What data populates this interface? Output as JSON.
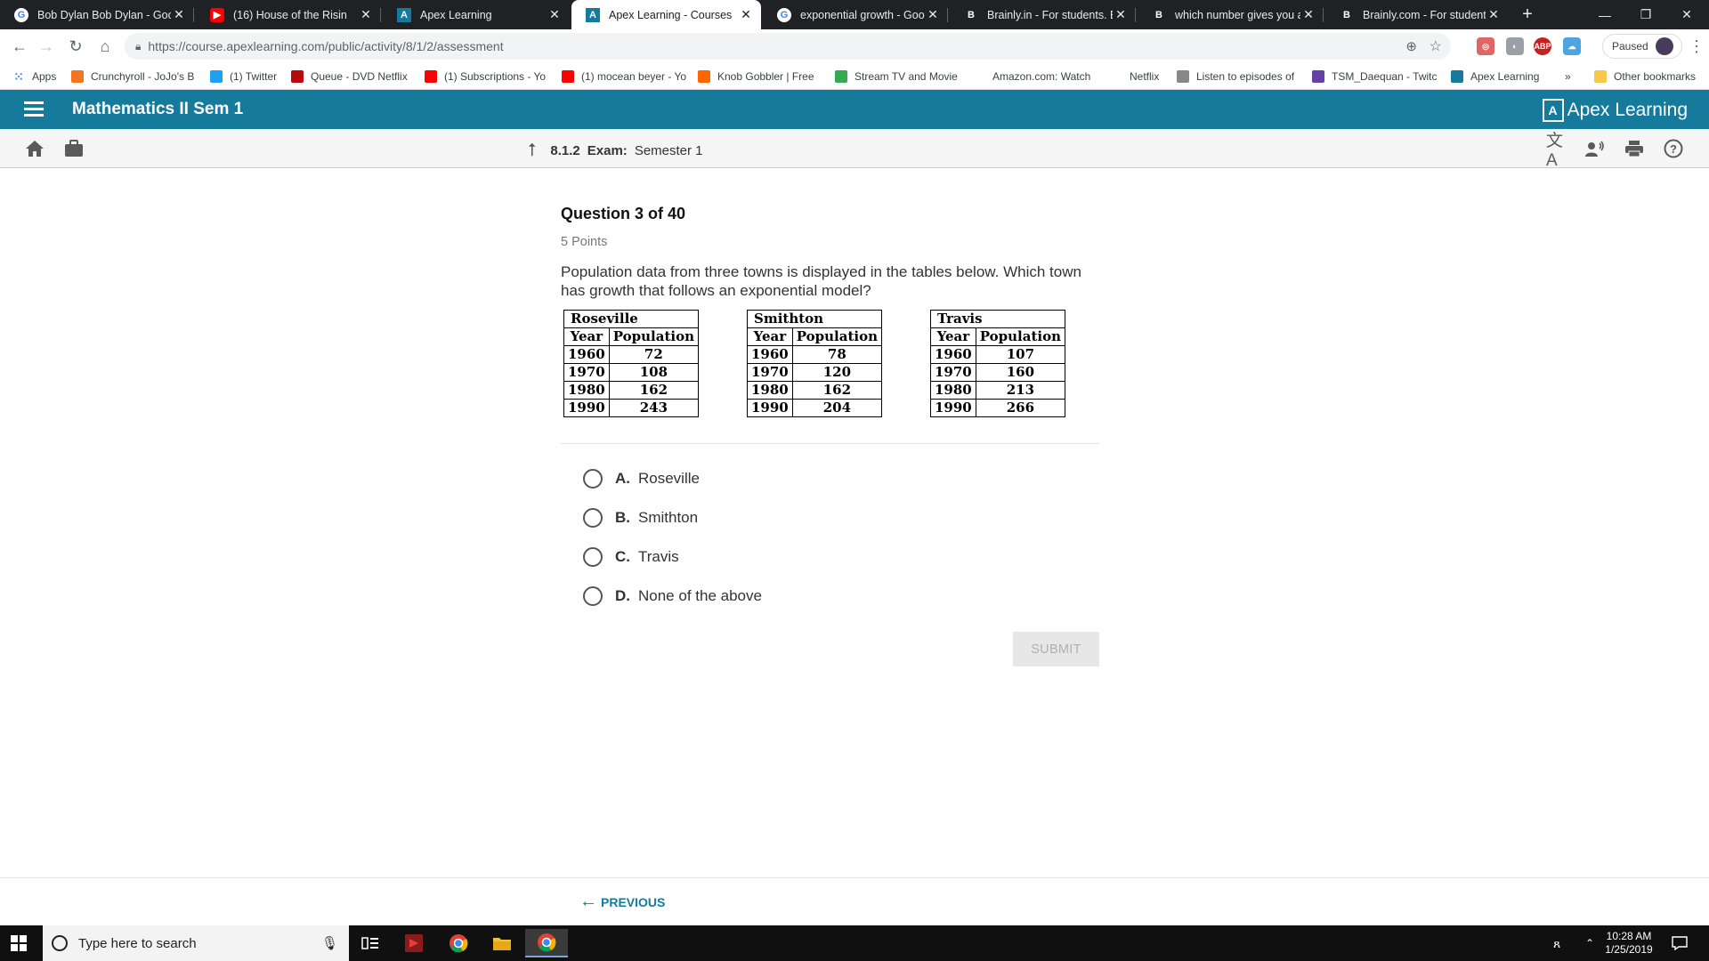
{
  "browser": {
    "tabs": [
      {
        "title": "Bob Dylan Bob Dylan - Goo",
        "icon": "google-icon",
        "active": false
      },
      {
        "title": "(16) House of the Risin",
        "icon": "youtube-icon",
        "active": false
      },
      {
        "title": "Apex Learning",
        "icon": "apex-icon",
        "active": false
      },
      {
        "title": "Apex Learning - Courses",
        "icon": "apex-icon",
        "active": true
      },
      {
        "title": "exponential growth - Goog",
        "icon": "google-icon",
        "active": false
      },
      {
        "title": "Brainly.in - For students. By",
        "icon": "brainly-icon",
        "active": false
      },
      {
        "title": "which number gives you an",
        "icon": "brainly-icon",
        "active": false
      },
      {
        "title": "Brainly.com - For students.",
        "icon": "brainly-icon",
        "active": false
      }
    ],
    "new_tab": "+",
    "close_glyph": "✕",
    "url": "https://course.apexlearning.com/public/activity/8/1/2/assessment",
    "profile_status": "Paused",
    "bookmarks": [
      "Apps",
      "Crunchyroll - JoJo's B",
      "(1) Twitter",
      "Queue - DVD Netflix",
      "(1) Subscriptions - Yo",
      "(1) mocean beyer - Yo",
      "Knob Gobbler | Free",
      "Stream TV and Movie",
      "Amazon.com: Watch",
      "Netflix",
      "Listen to episodes of",
      "TSM_Daequan - Twitc",
      "Apex Learning"
    ],
    "bookmarks_overflow": "»",
    "other_bookmarks": "Other bookmarks"
  },
  "app": {
    "course_title": "Mathematics II Sem 1",
    "logo_text": "Apex Learning",
    "breadcrumb": {
      "number": "8.1.2",
      "type": "Exam:",
      "name": "Semester 1"
    },
    "accent_color": "#157a9c"
  },
  "question": {
    "title": "Question 3 of 40",
    "points": "5 Points",
    "text": "Population data from three towns is displayed in the tables below. Which town has growth that follows an exponential model?",
    "tables": [
      {
        "town": "Roseville",
        "headers": [
          "Year",
          "Population"
        ],
        "rows": [
          [
            "1960",
            "72"
          ],
          [
            "1970",
            "108"
          ],
          [
            "1980",
            "162"
          ],
          [
            "1990",
            "243"
          ]
        ]
      },
      {
        "town": "Smithton",
        "headers": [
          "Year",
          "Population"
        ],
        "rows": [
          [
            "1960",
            "78"
          ],
          [
            "1970",
            "120"
          ],
          [
            "1980",
            "162"
          ],
          [
            "1990",
            "204"
          ]
        ]
      },
      {
        "town": "Travis",
        "headers": [
          "Year",
          "Population"
        ],
        "rows": [
          [
            "1960",
            "107"
          ],
          [
            "1970",
            "160"
          ],
          [
            "1980",
            "213"
          ],
          [
            "1990",
            "266"
          ]
        ]
      }
    ],
    "options": [
      {
        "letter": "A.",
        "text": "Roseville"
      },
      {
        "letter": "B.",
        "text": "Smithton"
      },
      {
        "letter": "C.",
        "text": "Travis"
      },
      {
        "letter": "D.",
        "text": "None of the above"
      }
    ],
    "submit_label": "SUBMIT",
    "previous_label": "PREVIOUS"
  },
  "taskbar": {
    "search_placeholder": "Type here to search",
    "time": "10:28 AM",
    "date": "1/25/2019"
  }
}
